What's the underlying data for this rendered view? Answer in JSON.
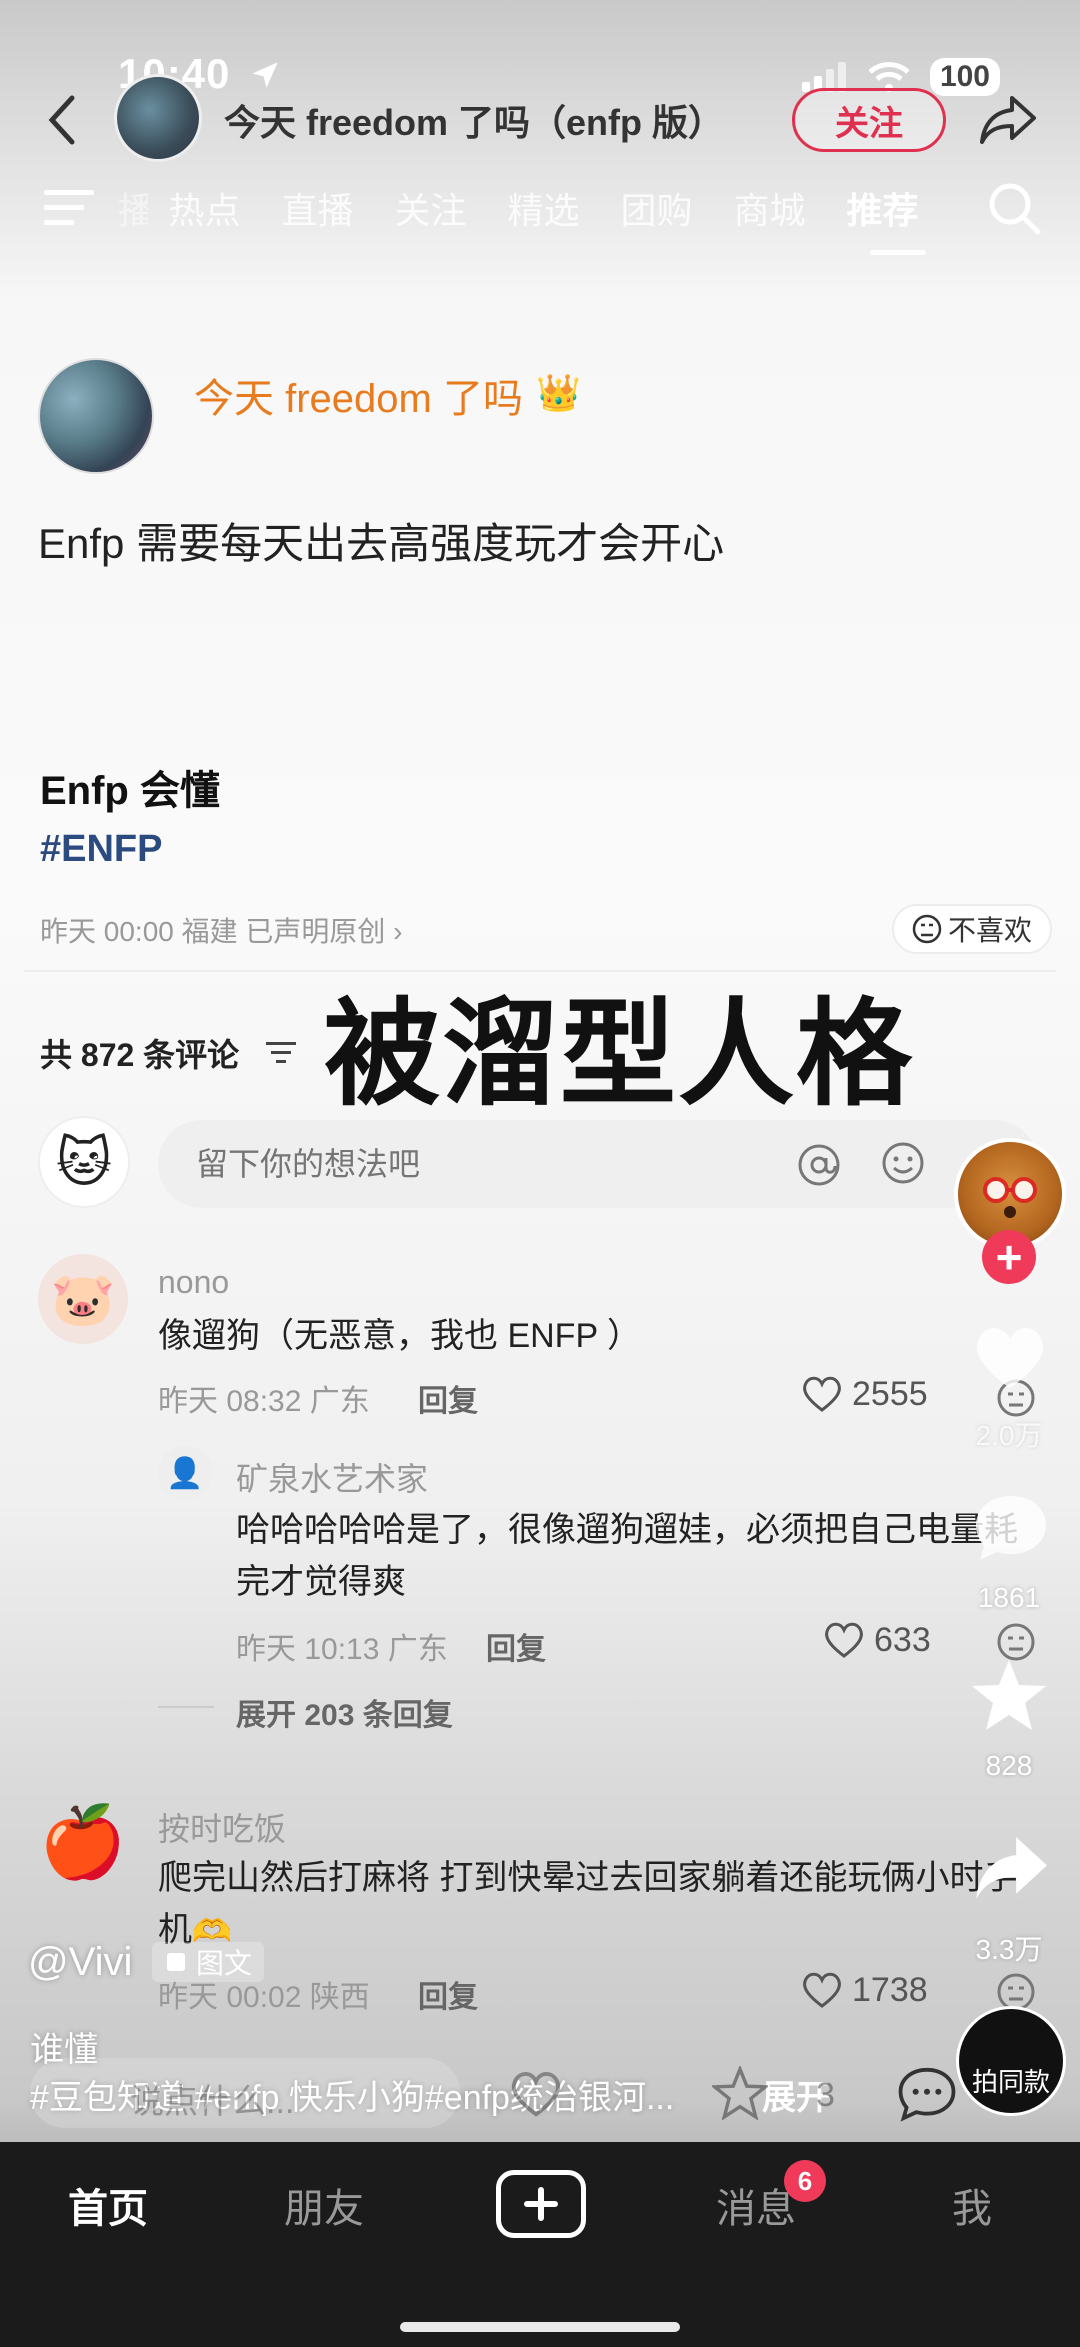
{
  "status_bar": {
    "time": "10:40",
    "battery": "100"
  },
  "header": {
    "title": "今天 freedom 了吗（enfp 版）",
    "follow_label": "关注"
  },
  "tabs": [
    {
      "label": "播"
    },
    {
      "label": "热点"
    },
    {
      "label": "直播"
    },
    {
      "label": "关注"
    },
    {
      "label": "精选"
    },
    {
      "label": "团购"
    },
    {
      "label": "商城"
    },
    {
      "label": "推荐"
    }
  ],
  "post": {
    "author": "今天 freedom 了吗",
    "text": "Enfp 需要每天出去高强度玩才会开心",
    "heading": "Enfp 会懂",
    "hashtag": "#ENFP",
    "meta": "昨天 00:00 福建  已声明原创 ›",
    "dislike_label": "不喜欢",
    "overlay_title": "被溜型人格"
  },
  "comments_section": {
    "count_label": "共 872 条评论",
    "input_placeholder": "留下你的想法吧"
  },
  "comments": [
    {
      "user": "nono",
      "text": "像遛狗（无恶意，我也 ENFP ）",
      "time": "昨天 08:32 广东",
      "reply": "回复",
      "likes": "2555"
    },
    {
      "user": "矿泉水艺术家",
      "text_line1": "哈哈哈哈哈是了，很像遛狗遛娃，必须把自己电量耗",
      "text_line2": "完才觉得爽",
      "time": "昨天 10:13 广东",
      "reply": "回复",
      "likes": "633",
      "expand": "展开 203 条回复"
    },
    {
      "user": "按时吃饭",
      "text_line1": "爬完山然后打麻将 打到快晕过去回家躺着还能玩俩小时手",
      "text_line2": "机",
      "time": "昨天 00:02 陕西",
      "reply": "回复",
      "likes": "1738"
    }
  ],
  "sidebar": {
    "likes": "2.0万",
    "comments": "1861",
    "favorites": "828",
    "shares": "3.3万"
  },
  "video_overlay": {
    "author": "@Vivi",
    "badge": "图文",
    "desc": "谁懂",
    "tags": "#豆包知道 #enfp 快乐小狗#enfp统治银河...",
    "expand": "展开",
    "take_same": "拍同款"
  },
  "bottom_bar_peek": {
    "placeholder": "说点什么...",
    "star_count": "3"
  },
  "nav": {
    "home": "首页",
    "friends": "朋友",
    "messages": "消息",
    "messages_badge": "6",
    "me": "我"
  },
  "colors": {
    "accent": "#e03050",
    "author_orange": "#e87b1d",
    "hashtag_blue": "#2b4b80",
    "nav_bg": "#1b1b1b"
  }
}
